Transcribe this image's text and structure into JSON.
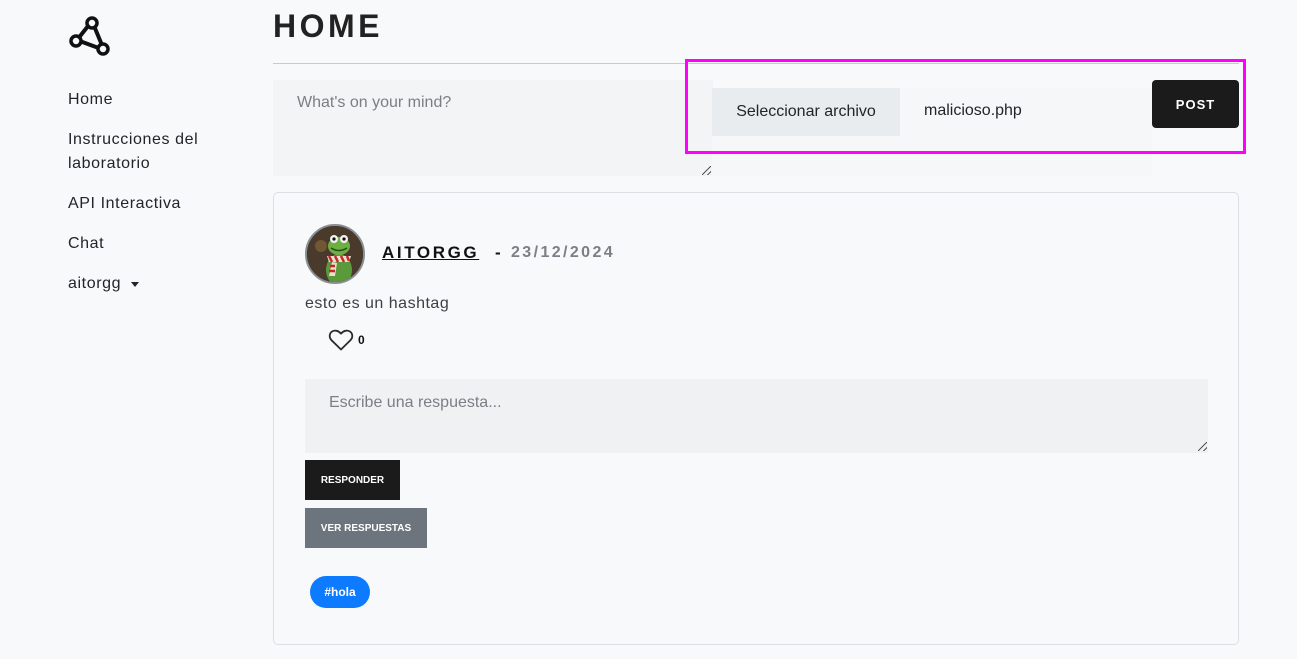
{
  "nav": {
    "items": [
      {
        "label": "Home"
      },
      {
        "label": "Instrucciones del laboratorio"
      },
      {
        "label": "API Interactiva"
      },
      {
        "label": "Chat"
      }
    ],
    "user": "aitorgg"
  },
  "page": {
    "title": "HOME"
  },
  "composer": {
    "placeholder": "What's on your mind?",
    "file_button": "Seleccionar archivo",
    "file_name": "malicioso.php",
    "post_button": "POST"
  },
  "post": {
    "author": "AITORGG ",
    "separator": "-",
    "date": "23/12/2024",
    "text": "esto es un hashtag",
    "likes": "0",
    "reply_placeholder": "Escribe una respuesta...",
    "reply_button": "RESPONDER",
    "view_replies_button": "VER RESPUESTAS",
    "hashtag": "#hola"
  },
  "colors": {
    "highlight": "#ff00ff",
    "post_button": "#1b1b1b",
    "view_button": "#6c757d",
    "hashtag_bg": "#0d7bff"
  },
  "icons": {
    "logo": "share-nodes-icon",
    "like": "heart-outline-icon",
    "dropdown": "caret-down-icon"
  }
}
